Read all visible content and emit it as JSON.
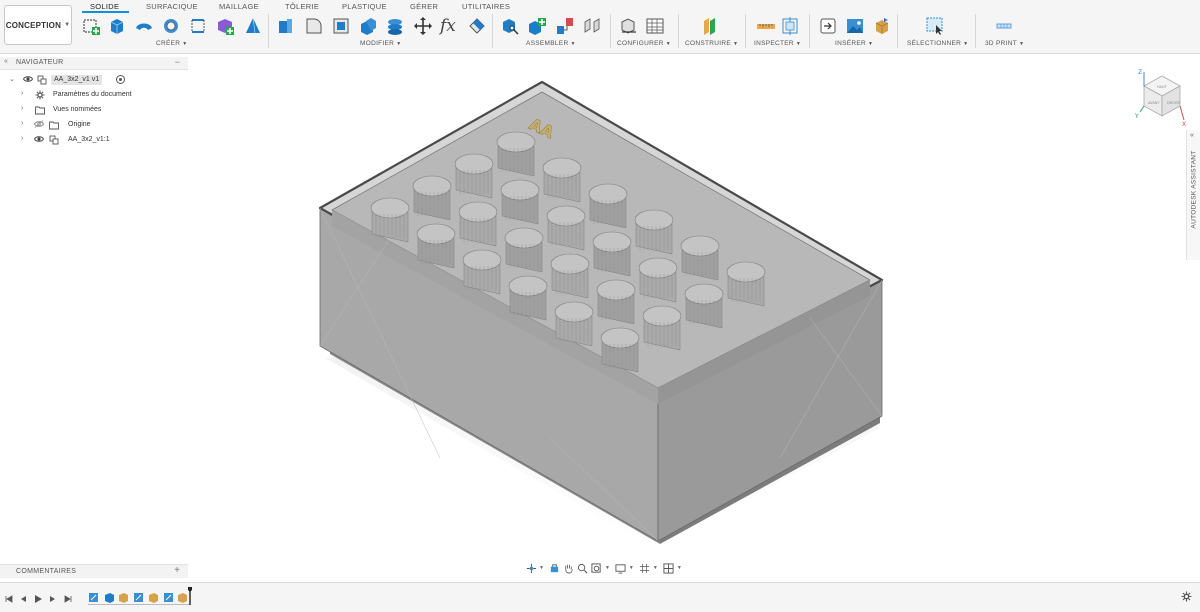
{
  "toolbar": {
    "workspace": {
      "label": "CONCEPTION",
      "icon": "chevron-down-icon"
    },
    "tabs": [
      "SOLIDE",
      "SURFACIQUE",
      "MAILLAGE",
      "TÔLERIE",
      "PLASTIQUE",
      "GÉRER",
      "UTILITAIRES"
    ],
    "active_tab": "SOLIDE",
    "groups": [
      "CRÉER",
      "MODIFIER",
      "ASSEMBLER",
      "CONFIGURER",
      "CONSTRUIRE",
      "INSPECTER",
      "INSÉRER",
      "SÉLECTIONNER",
      "3D PRINT"
    ],
    "fx_glyph": "fx",
    "accent": "#0696d7"
  },
  "navigator": {
    "title": "NAVIGATEUR",
    "minimize": "−",
    "rows": [
      {
        "label": "AA_3x2_v1 v1"
      },
      {
        "label": "Paramètres du document"
      },
      {
        "label": "Vues nommées"
      },
      {
        "label": "Origine"
      },
      {
        "label": "AA_3x2_v1:1"
      }
    ]
  },
  "viewport": {
    "text_embossed": "AA",
    "viewcube": {
      "x": "X",
      "y": "Y",
      "z": "Z",
      "top": "HAUT",
      "front": "AVANT",
      "right": "DROITE"
    },
    "model_color": "#a6a6a6"
  },
  "assistant": {
    "label": "AUTODESK ASSISTANT"
  },
  "comments": {
    "label": "COMMENTAIRES",
    "add": "+"
  },
  "timeline": {
    "feature_count": 6
  }
}
